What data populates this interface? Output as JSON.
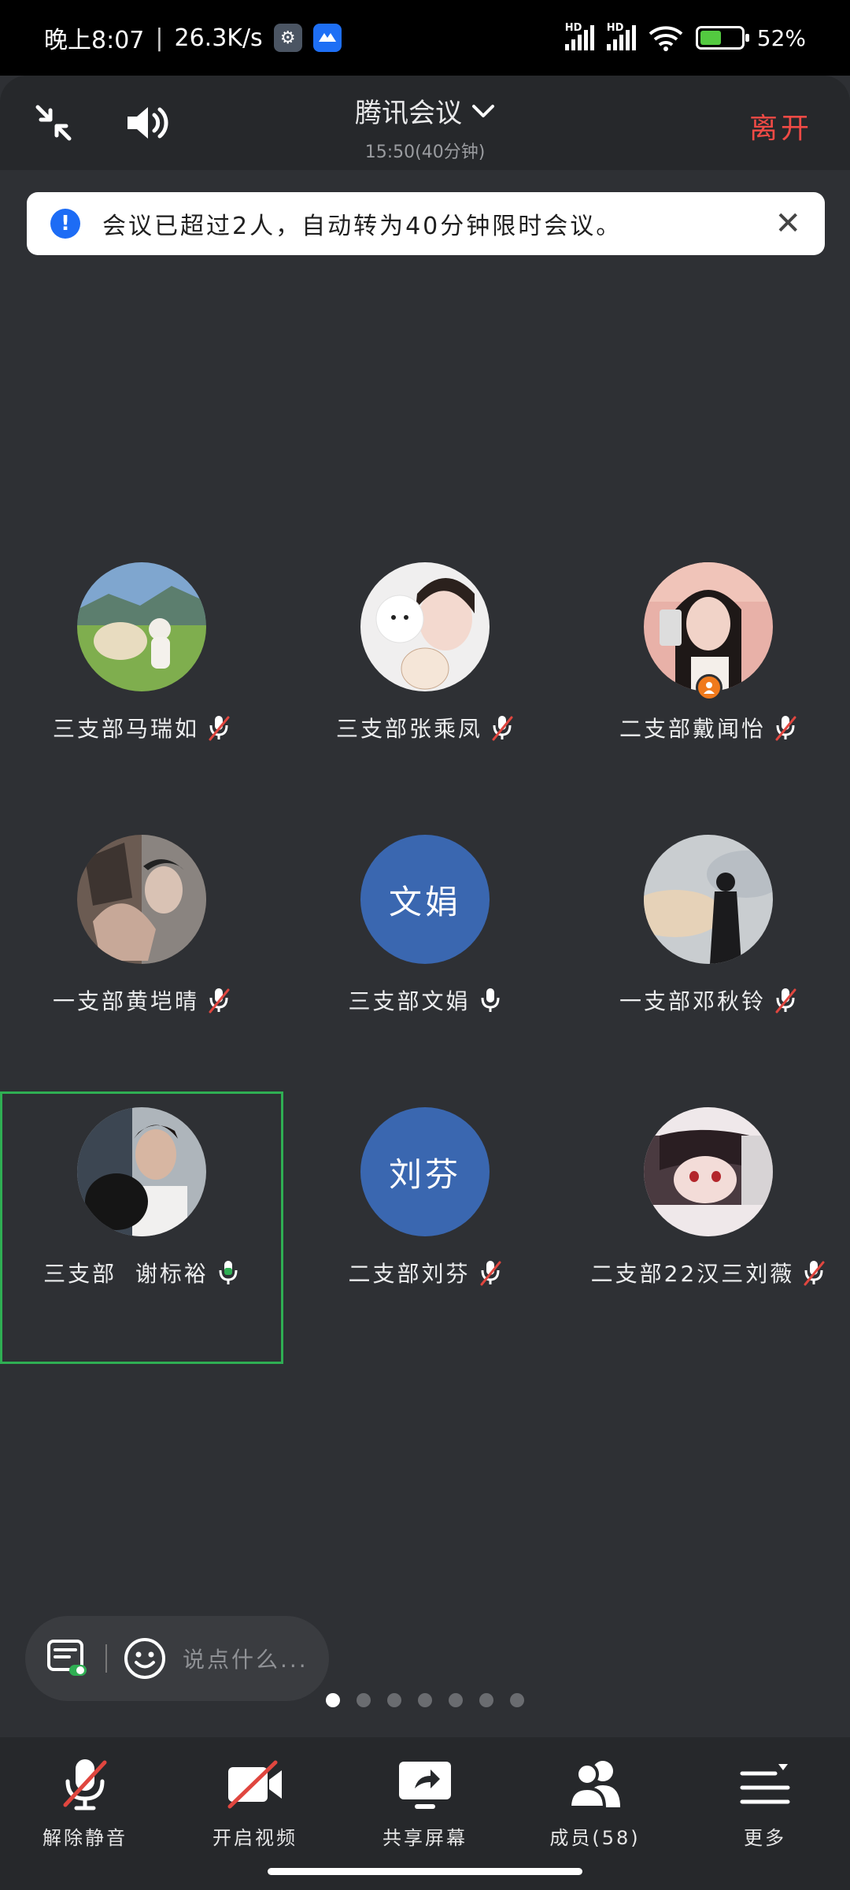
{
  "status_bar": {
    "time": "晚上8:07",
    "speed": "26.3K/s",
    "battery": "52%",
    "battery_level": 0.52,
    "signal_label": "HD"
  },
  "header": {
    "title": "腾讯会议",
    "subtitle": "15:50(40分钟)",
    "leave_label": "离开",
    "leave_color": "#ef4a45",
    "exit_fullscreen_icon": "collapse-arrows-icon",
    "speaker_icon": "speaker-icon"
  },
  "notice": {
    "text": "会议已超过2人，自动转为40分钟限时会议。",
    "close_label": "✕"
  },
  "participants": [
    {
      "name": "三支部马瑞如",
      "avatar_text": "",
      "muted": true
    },
    {
      "name": "三支部张乘凤",
      "avatar_text": "",
      "muted": true
    },
    {
      "name": "二支部戴闻怡",
      "avatar_text": "",
      "muted": true,
      "host_badge": true
    },
    {
      "name": "一支部黄垲晴",
      "avatar_text": "",
      "muted": true
    },
    {
      "name": "三支部文娟",
      "avatar_text": "文娟",
      "muted": false
    },
    {
      "name": "一支部邓秋铃",
      "avatar_text": "",
      "muted": true
    },
    {
      "name": "三支部  谢标裕",
      "avatar_text": "",
      "muted": false,
      "speaking": true,
      "active": true
    },
    {
      "name": "二支部刘芬",
      "avatar_text": "刘芬",
      "muted": true
    },
    {
      "name": "二支部22汉三刘薇",
      "avatar_text": "",
      "muted": true
    }
  ],
  "chat": {
    "placeholder": "说点什么..."
  },
  "pagination": {
    "count": 7,
    "current": 1
  },
  "toolbar": {
    "unmute_label": "解除静音",
    "video_label": "开启视频",
    "share_label": "共享屏幕",
    "members_label": "成员(58)",
    "more_label": "更多"
  },
  "colors": {
    "accent_green": "#2fae53",
    "muted_red": "#e0463f",
    "avatar_blue": "#3a67b0"
  }
}
